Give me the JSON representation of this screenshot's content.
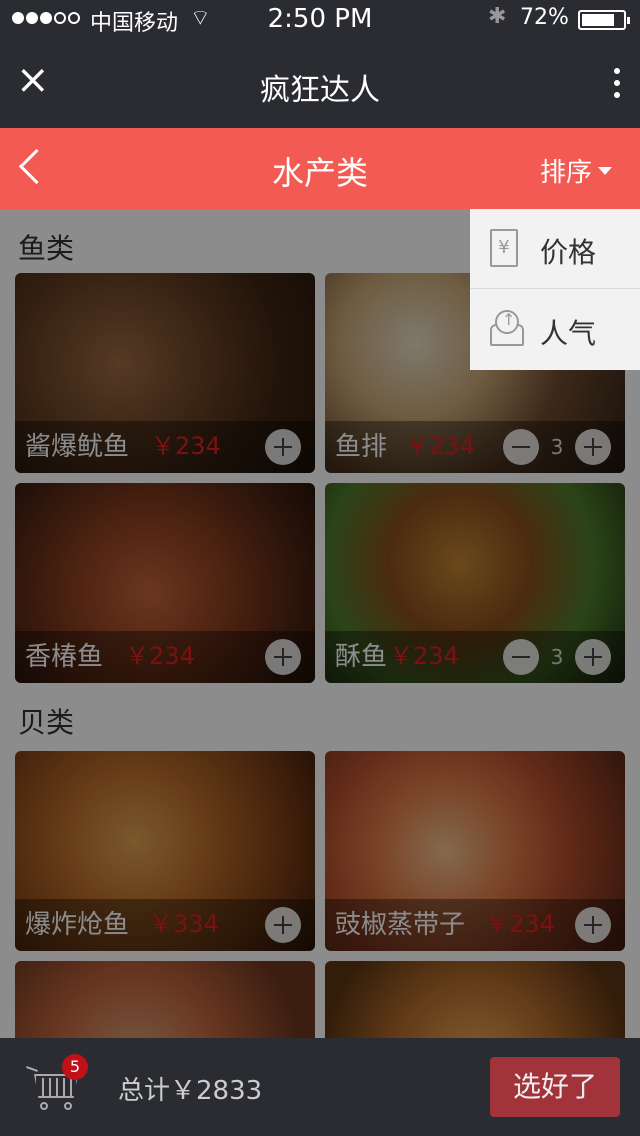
{
  "status_bar": {
    "carrier": "中国移动",
    "time": "2:50 PM",
    "battery": "72%",
    "signal_bars": 3,
    "signal_total": 5
  },
  "app_bar": {
    "title": "疯狂达人",
    "close_icon": "close-icon",
    "more_icon": "more-vertical-icon"
  },
  "nav": {
    "title": "水产类",
    "sort_label": "排序"
  },
  "sort_menu": [
    {
      "label": "价格",
      "icon": "yuan-price-icon",
      "icon_glyph": "¥"
    },
    {
      "label": "人气",
      "icon": "popularity-icon"
    }
  ],
  "sections": [
    {
      "title": "鱼类",
      "items": [
        {
          "name": "酱爆鱿鱼",
          "price": "￥234"
        },
        {
          "name": "鱼排",
          "price": "￥234",
          "qty": "3"
        },
        {
          "name": "香椿鱼",
          "price": "￥234"
        },
        {
          "name": "酥鱼",
          "price": "￥234",
          "qty": "3"
        }
      ]
    },
    {
      "title": "贝类",
      "items": [
        {
          "name": "爆炸炝鱼",
          "price": "￥334"
        },
        {
          "name": "豉椒蒸带子",
          "price": "￥234"
        }
      ]
    }
  ],
  "cart": {
    "count": "5",
    "total": "总计￥2833",
    "confirm_label": "选好了"
  },
  "colors": {
    "accent": "#f25a53",
    "dark_bar": "#2a2c31",
    "price_red": "#e02020",
    "badge_red": "#c0101a",
    "confirm_button": "#a3333a"
  }
}
